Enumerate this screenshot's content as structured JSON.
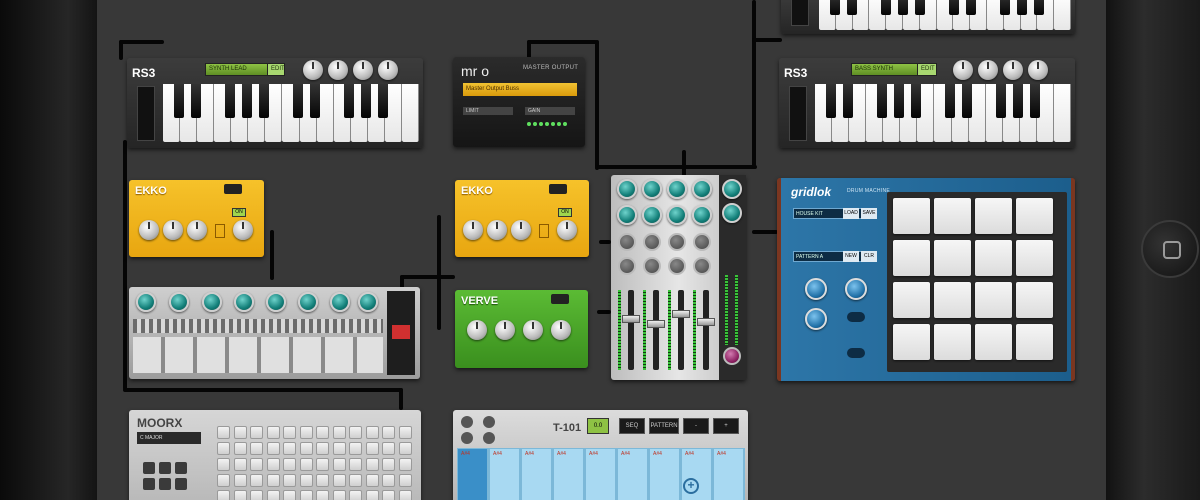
{
  "devices": {
    "rs53_left": {
      "name": "RS3",
      "lcd": "SYNTH LEAD",
      "lcd_btn": "EDIT",
      "knob_labels": [
        "",
        "",
        "",
        ""
      ]
    },
    "rs53_right": {
      "name": "RS3",
      "lcd": "BASS SYNTH",
      "lcd_btn": "EDIT"
    },
    "mrno": {
      "logo": "mr o",
      "subtitle": "MASTER OUTPUT",
      "display": "Master Output Buss",
      "field1": "LIMIT",
      "field2": "GAIN"
    },
    "ekko_left": {
      "name": "EKKO",
      "btn": "ON"
    },
    "ekko_right": {
      "name": "EKKO",
      "btn": "ON"
    },
    "verve": {
      "name": "VERVE",
      "knob_labels": [
        "",
        "",
        "",
        ""
      ]
    },
    "gridlok": {
      "name": "gridlok",
      "subtitle": "DRUM MACHINE",
      "row1": "HOUSE KIT",
      "row1_btn1": "LOAD",
      "row1_btn2": "SAVE",
      "row2": "PATTERN A",
      "row2_btn1": "NEW",
      "row2_btn2": "CLR"
    },
    "moorx": {
      "name": "MOORX",
      "lcd": "C MAJOR"
    },
    "t101": {
      "name": "T-101",
      "display": "0.0",
      "btn1": "SEQ",
      "btn2": "PATTERN",
      "btn3": "-",
      "btn4": "+",
      "add_icon": "plus-icon"
    }
  },
  "step_labels": [
    "A#4",
    "A#4",
    "A#4",
    "A#4",
    "A#4",
    "A#4",
    "A#4",
    "A#4",
    "A#4"
  ],
  "colors": {
    "ekko": "#f1b41b",
    "verve": "#49a72b",
    "gridlok": "#2a6f9f",
    "teal_knob": "#137f79",
    "lcd": "#8ec244"
  }
}
